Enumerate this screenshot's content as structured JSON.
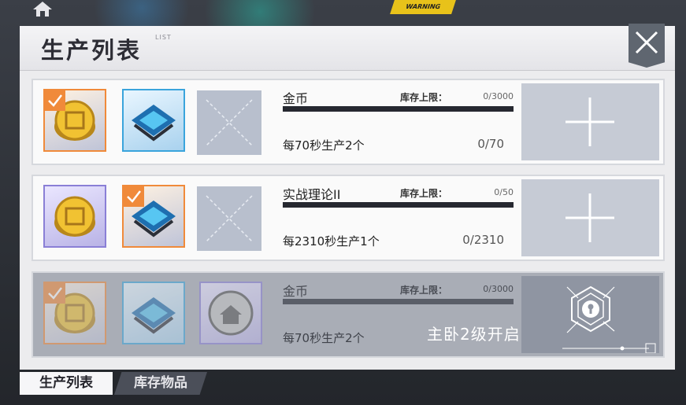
{
  "header": {
    "title": "生产列表",
    "subtitle": "LIST",
    "close_icon": "close-x-icon"
  },
  "background": {
    "warning_sign": "WARNING",
    "home_icon": "home-icon"
  },
  "production_list": [
    {
      "item_name": "金币",
      "cap_label": "库存上限：",
      "cap_value": "0/3000",
      "rate_text": "每70秒生产2个",
      "progress_text": "0/70",
      "materials": [
        "gold-coin-icon",
        "blue-chip-icon",
        "empty-slot-icon"
      ],
      "selected_slot": 1,
      "action_icon": "plus-icon",
      "locked": false
    },
    {
      "item_name": "实战理论II",
      "cap_label": "库存上限：",
      "cap_value": "0/50",
      "rate_text": "每2310秒生产1个",
      "progress_text": "0/2310",
      "materials": [
        "gold-coin-icon",
        "blue-chip-icon",
        "empty-slot-icon"
      ],
      "selected_slot": 2,
      "action_icon": "plus-icon",
      "locked": false
    },
    {
      "item_name": "金币",
      "cap_label": "库存上限：",
      "cap_value": "0/3000",
      "rate_text": "每70秒生产2个",
      "unlock_text": "主卧2级开启",
      "materials": [
        "gold-coin-icon",
        "blue-chip-icon",
        "house-coin-icon"
      ],
      "selected_slot": 1,
      "action_icon": "keyhole-lock-icon",
      "locked": true
    }
  ],
  "tabs": [
    {
      "label": "生产列表",
      "active": true
    },
    {
      "label": "库存物品",
      "active": false
    }
  ],
  "colors": {
    "orange_accent": "#f08a3a",
    "blue_accent": "#3aa4dc",
    "purple_accent": "#8a7fd6",
    "bar_dark": "#262830"
  }
}
